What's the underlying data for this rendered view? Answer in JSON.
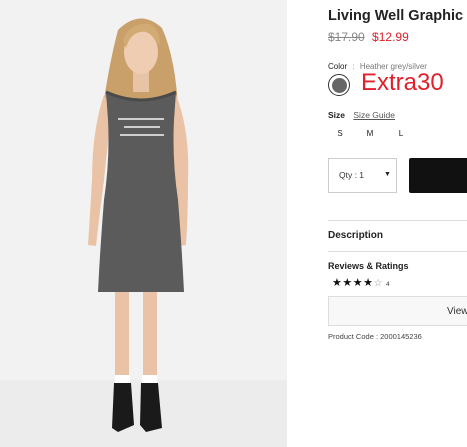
{
  "product": {
    "title": "Living Well Graphic",
    "original_price": "$17.90",
    "sale_price": "$12.99",
    "color_label": "Color",
    "color_separator": ":",
    "color_value": "Heather grey/silver",
    "swatch_color": "#666666",
    "promo_text": "Extra30",
    "size_label": "Size",
    "size_guide_label": "Size Guide",
    "sizes": [
      "S",
      "M",
      "L"
    ],
    "qty_label": "Qty : 1",
    "description_label": "Description",
    "reviews_label": "Reviews & Ratings",
    "rating": 4,
    "rating_max": 5,
    "review_count": "4",
    "view_label": "View",
    "product_code": "Product Code : 2000145236"
  },
  "colors": {
    "sale": "#e0202a",
    "promo": "#e0202a",
    "button": "#111111"
  }
}
